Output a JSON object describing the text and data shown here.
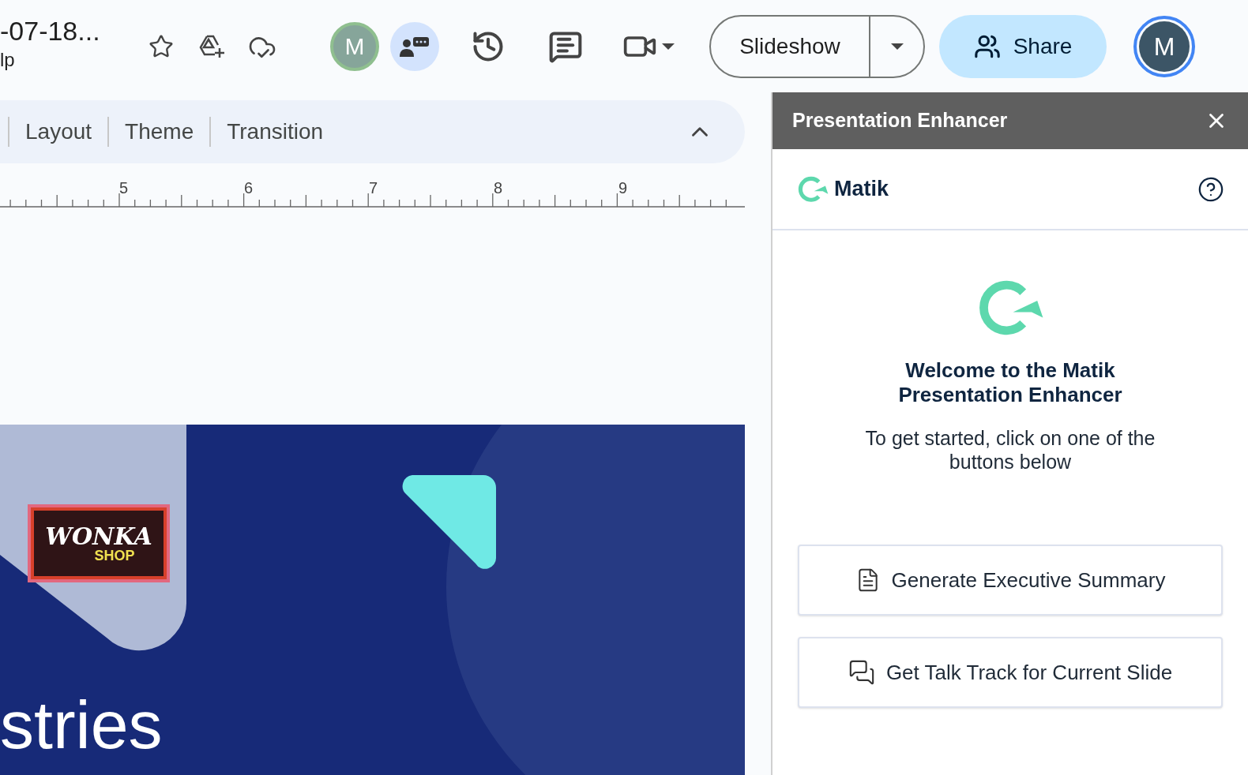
{
  "header": {
    "doc_title": "-07-18...",
    "menu_fragment": "lp",
    "collaborator_avatar": "M",
    "slideshow_button": "Slideshow",
    "share_button": "Share",
    "account_avatar": "M"
  },
  "toolbar": {
    "items": [
      "Layout",
      "Theme",
      "Transition"
    ],
    "expanded": true
  },
  "ruler": {
    "labels": [
      "5",
      "6",
      "7",
      "8",
      "9"
    ]
  },
  "slide": {
    "logo_top": "WONKA",
    "logo_bottom": "SHOP",
    "title_fragment": "stries"
  },
  "panel": {
    "title": "Presentation Enhancer",
    "brand": "Matik",
    "welcome_title": "Welcome to the Matik Presentation Enhancer",
    "welcome_text": "To get started, click on one of the buttons below",
    "actions": [
      {
        "kind": "summary",
        "label": "Generate Executive Summary"
      },
      {
        "kind": "talk",
        "label": "Get Talk Track for Current Slide"
      }
    ]
  }
}
